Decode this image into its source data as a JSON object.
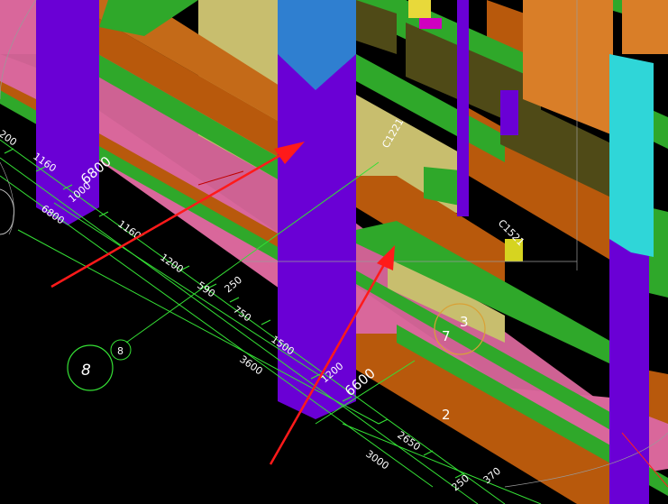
{
  "viewport": {
    "name": "3D structural model view",
    "colors": {
      "background": "#000000",
      "wall_pink": "#d9679b",
      "column_purple": "#6a00d5",
      "column_top_blue": "#2f7fd0",
      "column_top_cyan": "#2fd6d8",
      "beam_orange": "#b8590c",
      "beam_green": "#2fa82a",
      "opening_khaki": "#c8be6e",
      "dimension_line": "#35e035",
      "axis_bubble": "#d9a136",
      "arrow": "#ff1a1a"
    }
  },
  "dimensions": {
    "left_run": [
      "6800",
      "1160",
      "1000",
      "6800",
      "1160",
      "1200",
      "590",
      "250",
      "750",
      "1500",
      "3600",
      "1200",
      "6600"
    ],
    "bottom_run": [
      "2650",
      "3000",
      "250",
      "370"
    ],
    "far_left": "200",
    "top_left_1160": "1160"
  },
  "axis_labels": {
    "grid_8_large": "8",
    "grid_8_small": "8",
    "grid_7": "7",
    "grid_3": "3",
    "grid_2": "2"
  },
  "openings": {
    "c1221": "C1221",
    "c1521": "C1521"
  }
}
